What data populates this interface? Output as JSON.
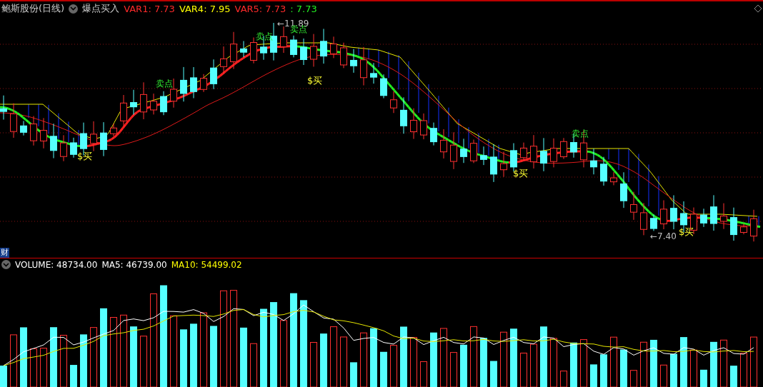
{
  "header": {
    "stock": "鲍斯股份(日线)",
    "indicator": "爆点买入",
    "values": [
      {
        "text": "VAR1: 7.73",
        "color": "#ff2a2a"
      },
      {
        "text": "VAR4: 7.95",
        "color": "#ffff00"
      },
      {
        "text": "VAR5: 7.73",
        "color": "#ff2a2a"
      },
      {
        "text": ": 7.73",
        "color": "#22ee22"
      }
    ]
  },
  "chart_labels": [
    {
      "text": "←11.89",
      "kind": "price"
    },
    {
      "text": "卖点",
      "kind": "sell"
    },
    {
      "text": "卖点",
      "kind": "sell"
    },
    {
      "text": "卖点",
      "kind": "sell"
    },
    {
      "text": "卖点",
      "kind": "sell"
    },
    {
      "text": "$买",
      "kind": "buy"
    },
    {
      "text": "$买",
      "kind": "buy"
    },
    {
      "text": "$买",
      "kind": "buy"
    },
    {
      "text": "$买",
      "kind": "buy"
    },
    {
      "text": "←7.40",
      "kind": "price"
    }
  ],
  "side_tab": "财",
  "volume": {
    "values": [
      {
        "text": "VOLUME: 48734.00",
        "color": "#ffffff"
      },
      {
        "text": "MA5: 46739.00",
        "color": "#ffffff"
      },
      {
        "text": "MA10: 54499.02",
        "color": "#ffff00"
      }
    ]
  }
}
